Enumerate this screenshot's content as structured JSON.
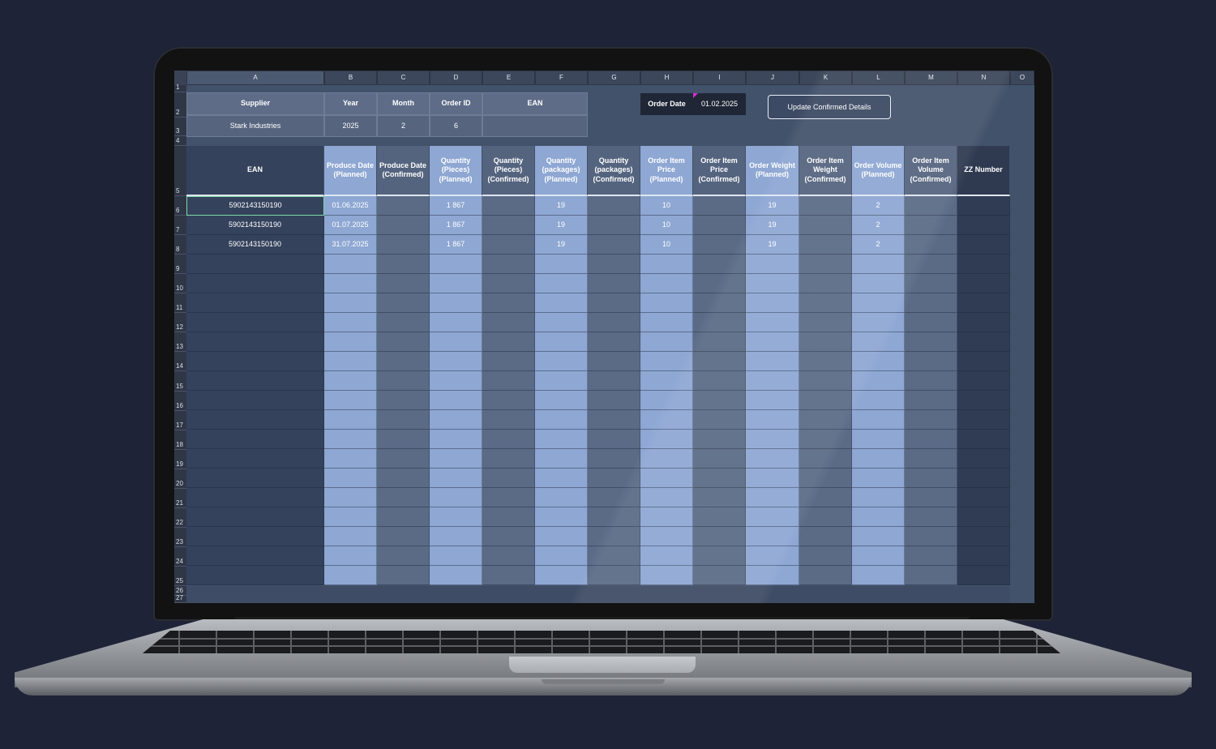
{
  "columns": [
    "A",
    "B",
    "C",
    "D",
    "E",
    "F",
    "G",
    "H",
    "I",
    "J",
    "K",
    "L",
    "M",
    "N",
    "O"
  ],
  "row_numbers": [
    "1",
    "2",
    "3",
    "4",
    "5",
    "6",
    "7",
    "8",
    "9",
    "10",
    "11",
    "12",
    "13",
    "14",
    "15",
    "16",
    "17",
    "18",
    "19",
    "20",
    "21",
    "22",
    "23",
    "24",
    "25",
    "26",
    "27"
  ],
  "info": {
    "headers": [
      "Supplier",
      "Year",
      "Month",
      "Order ID",
      "EAN"
    ],
    "values": [
      "Stark Industries",
      "2025",
      "2",
      "6",
      ""
    ]
  },
  "order_date": {
    "label": "Order Date",
    "value": "01.02.2025"
  },
  "update_button": "Update Confirmed Details",
  "table_headers": [
    "EAN",
    "Produce Date (Planned)",
    "Produce Date (Confirmed)",
    "Quantity (Pieces) (Planned)",
    "Quantity (Pieces) (Confirmed)",
    "Quantity (packages) (Planned)",
    "Quantity (packages) (Confirmed)",
    "Order Item Price (Planned)",
    "Order Item Price (Confirmed)",
    "Order Weight (Planned)",
    "Order Item Weight (Confirmed)",
    "Order Volume (Planned)",
    "Order Item Volume (Confirmed)",
    "ZZ Number"
  ],
  "rows": [
    [
      "5902143150190",
      "01.06.2025",
      "",
      "1 867",
      "",
      "19",
      "",
      "10",
      "",
      "19",
      "",
      "2",
      "",
      ""
    ],
    [
      "5902143150190",
      "01.07.2025",
      "",
      "1 867",
      "",
      "19",
      "",
      "10",
      "",
      "19",
      "",
      "2",
      "",
      ""
    ],
    [
      "5902143150190",
      "31.07.2025",
      "",
      "1 867",
      "",
      "19",
      "",
      "10",
      "",
      "19",
      "",
      "2",
      "",
      ""
    ]
  ],
  "colors": {
    "planned": "#8ea7d3",
    "confirmed": "#5b6b86",
    "ean_col": "#34425c",
    "zz_col": "#303c54",
    "info_fill": "#5e6c87",
    "selected_border": "#7fd7a3",
    "note_marker": "#d62fd8"
  }
}
